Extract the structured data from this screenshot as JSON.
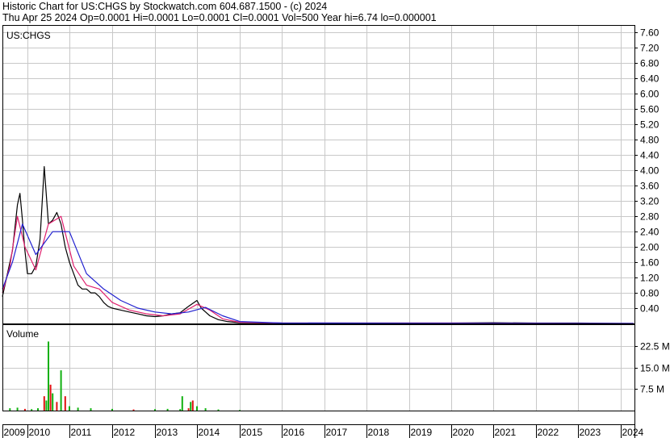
{
  "header": {
    "line1": "Historic Chart for US:CHGS by Stockwatch.com 604.687.1500 - (c) 2024",
    "line2": "Thu Apr 25 2024  Op=0.0001  Hi=0.0001  Lo=0.0001  Cl=0.0001  Vol=500  Year hi=6.74  lo=0.000001"
  },
  "colors": {
    "grid": "#c8c8c8",
    "price": "#000000",
    "ma_short": "#e0206e",
    "ma_long": "#2020d0",
    "vol_up": "#10b010",
    "vol_down": "#e01010"
  },
  "chart_data": [
    {
      "type": "line",
      "title": "US:CHGS",
      "ylim": [
        0,
        7.8
      ],
      "y_ticks": [
        "7.60",
        "7.20",
        "6.80",
        "6.40",
        "6.00",
        "5.60",
        "5.20",
        "4.80",
        "4.40",
        "4.00",
        "3.60",
        "3.20",
        "2.80",
        "2.40",
        "2.00",
        "1.60",
        "1.20",
        "0.80",
        "0.40"
      ],
      "x_tick_labels": [
        "2009",
        "2010",
        "2011",
        "2012",
        "2013",
        "2014",
        "2015",
        "2016",
        "2017",
        "2018",
        "2019",
        "2020",
        "2021",
        "2022",
        "2023",
        "2024"
      ],
      "grid": true,
      "series": [
        {
          "x": [
            2009.0,
            2009.1,
            2009.2,
            2009.3,
            2009.4,
            2009.5,
            2009.6,
            2009.7,
            2009.8,
            2009.9,
            2010.0,
            2010.1,
            2010.2,
            2010.3,
            2010.4,
            2010.5,
            2010.6,
            2010.7,
            2010.8,
            2010.9,
            2011.0,
            2011.1,
            2011.2,
            2011.3,
            2011.4,
            2011.5,
            2011.6,
            2011.7,
            2011.8,
            2011.9,
            2012.0,
            2012.2,
            2012.4,
            2012.6,
            2012.8,
            2013.0,
            2013.2,
            2013.4,
            2013.6,
            2013.8,
            2014.0,
            2014.1,
            2014.3,
            2014.5,
            2014.7,
            2015.0,
            2016.0,
            2017.0,
            2018.0,
            2019.0,
            2020.0,
            2021.0,
            2022.0,
            2023.0,
            2024.3
          ],
          "values": [
            0.7,
            1.0,
            1.3,
            1.6,
            1.9,
            2.5,
            3.1,
            3.4,
            2.7,
            1.9,
            1.3,
            1.3,
            1.5,
            2.2,
            4.1,
            2.6,
            2.7,
            2.9,
            2.6,
            2.0,
            1.6,
            1.3,
            1.0,
            0.9,
            0.9,
            0.8,
            0.8,
            0.7,
            0.55,
            0.45,
            0.4,
            0.35,
            0.3,
            0.25,
            0.2,
            0.18,
            0.2,
            0.25,
            0.28,
            0.45,
            0.6,
            0.4,
            0.2,
            0.1,
            0.05,
            0.02,
            0.01,
            0.01,
            0.01,
            0.01,
            0.01,
            0.02,
            0.01,
            0.01,
            0.0001
          ]
        },
        {
          "x": [
            2009.0,
            2009.3,
            2009.6,
            2009.9,
            2010.2,
            2010.5,
            2010.8,
            2011.1,
            2011.4,
            2011.7,
            2012.0,
            2012.4,
            2012.8,
            2013.2,
            2013.6,
            2014.0,
            2014.3,
            2014.6,
            2015.0,
            2016.0,
            2020.0,
            2024.3
          ],
          "values": [
            0.8,
            1.5,
            2.8,
            2.0,
            1.4,
            2.6,
            2.8,
            1.5,
            1.0,
            0.9,
            0.55,
            0.35,
            0.25,
            0.2,
            0.25,
            0.5,
            0.35,
            0.12,
            0.03,
            0.01,
            0.01,
            0.0001
          ]
        },
        {
          "x": [
            2009.0,
            2009.4,
            2009.8,
            2010.2,
            2010.6,
            2011.0,
            2011.4,
            2011.8,
            2012.2,
            2012.6,
            2013.0,
            2013.4,
            2013.8,
            2014.2,
            2014.6,
            2015.0,
            2016.0,
            2024.3
          ],
          "values": [
            0.9,
            1.6,
            2.6,
            1.8,
            2.4,
            2.4,
            1.3,
            0.9,
            0.6,
            0.4,
            0.3,
            0.25,
            0.3,
            0.42,
            0.2,
            0.05,
            0.01,
            0.0001
          ]
        }
      ]
    },
    {
      "type": "bar",
      "title": "Volume",
      "ylim": [
        0,
        30
      ],
      "y_ticks": [
        "22.5 M",
        "15.0 M",
        "7.5 M"
      ],
      "x": [
        2009.3,
        2009.6,
        2009.9,
        2010.1,
        2010.25,
        2010.4,
        2010.45,
        2010.5,
        2010.55,
        2010.6,
        2010.7,
        2010.8,
        2010.9,
        2011.0,
        2011.2,
        2011.5,
        2012.0,
        2012.5,
        2013.0,
        2013.3,
        2013.6,
        2013.65,
        2013.8,
        2013.85,
        2013.9,
        2014.0,
        2014.2,
        2014.5,
        2015.0
      ],
      "values": [
        0.8,
        1.0,
        0.6,
        0.5,
        0.8,
        5.0,
        3.5,
        24.0,
        9.0,
        6.0,
        3.0,
        14.0,
        5.0,
        1.5,
        1.0,
        0.8,
        0.6,
        0.4,
        0.5,
        0.6,
        0.5,
        5.0,
        0.8,
        3.0,
        3.5,
        1.5,
        0.8,
        0.4,
        0.2
      ],
      "up": [
        true,
        true,
        false,
        true,
        true,
        false,
        true,
        true,
        false,
        true,
        false,
        true,
        false,
        true,
        true,
        true,
        true,
        false,
        true,
        true,
        true,
        true,
        false,
        true,
        false,
        true,
        true,
        true,
        true
      ]
    }
  ]
}
